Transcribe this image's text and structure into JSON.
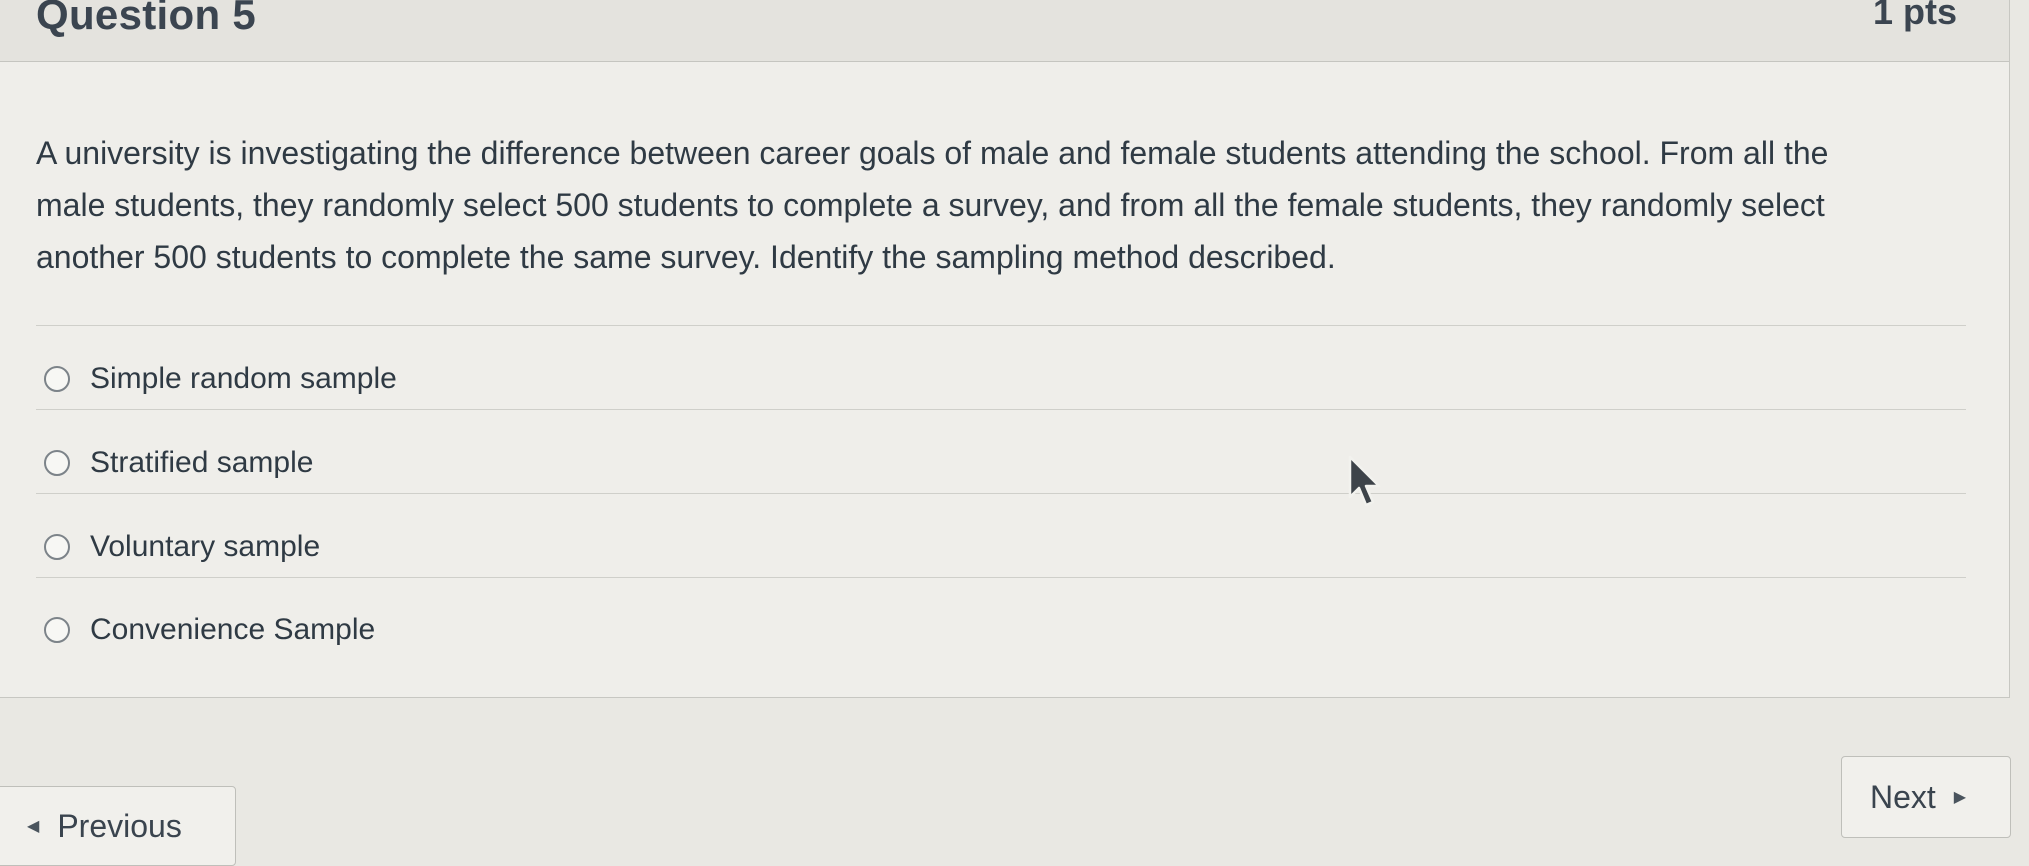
{
  "question": {
    "title": "Question 5",
    "points": "1 pts",
    "lines": [
      "A university is investigating the difference between career goals of male and female students attending the school. From all the",
      "male students, they randomly select 500 students to complete a survey, and from all the female students, they randomly select",
      "another 500 students to complete the same survey. Identify the sampling method described."
    ]
  },
  "answers": [
    {
      "label": "Simple random sample",
      "selected": false
    },
    {
      "label": "Stratified sample",
      "selected": false
    },
    {
      "label": "Voluntary sample",
      "selected": false
    },
    {
      "label": "Convenience Sample",
      "selected": false
    }
  ],
  "navigation": {
    "previous_label": "Previous",
    "next_label": "Next",
    "previous_icon": "triangle-left-icon",
    "next_icon": "triangle-right-icon"
  },
  "colors": {
    "page_background": "#e9e8e3",
    "card_background": "#efeeea",
    "text": "#2f3a44",
    "radio_border": "#7c8389"
  }
}
